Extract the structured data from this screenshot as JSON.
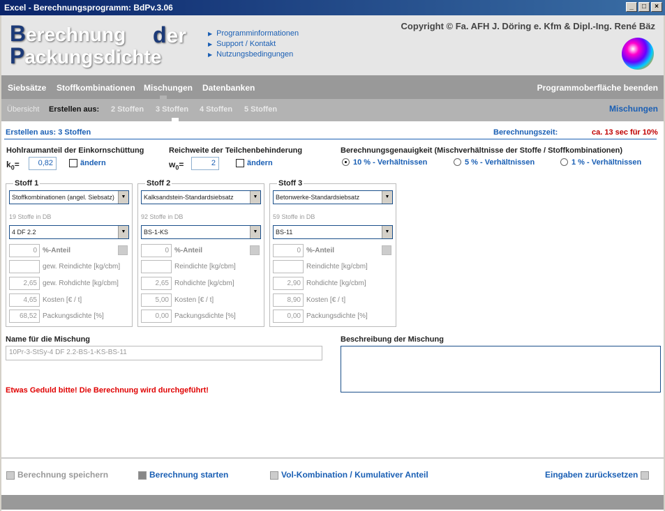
{
  "window": {
    "title": "Excel - Berechnungsprogramm: BdPv.3.06",
    "min_glyph": "_",
    "max_glyph": "□",
    "close_glyph": "×"
  },
  "logo": {
    "line1_cap": "B",
    "line1_rest": "erechnung",
    "der_cap": "d",
    "der_rest": "er",
    "line2_cap": "P",
    "line2_rest": "ackungsdichte"
  },
  "links": [
    "Programminformationen",
    "Support / Kontakt",
    "Nutzungsbedingungen"
  ],
  "copyright": "Copyright © Fa. AFH J. Döring e. Kfm & Dipl.-Ing. René Bäz",
  "nav1": {
    "items": [
      "Siebsätze",
      "Stoffkombinationen",
      "Mischungen",
      "Datenbanken"
    ],
    "exit": "Programmoberfläche beenden"
  },
  "nav2": {
    "overview": "Übersicht",
    "create_label": "Erstellen aus:",
    "items": [
      "2 Stoffen",
      "3 Stoffen",
      "4 Stoffen",
      "5 Stoffen"
    ],
    "section": "Mischungen"
  },
  "section": {
    "title": "Erstellen aus: 3 Stoffen",
    "calc_time_label": "Berechnungszeit:",
    "calc_time_value": "ca. 13 sec für 10%"
  },
  "hohlraum": {
    "label": "Hohlraumanteil der Einkornschüttung",
    "sym": "k",
    "sub": "0",
    "eq": "=",
    "value": "0,82",
    "change": "ändern"
  },
  "reichweite": {
    "label": "Reichweite der Teilchenbehinderung",
    "sym": "w",
    "sub": "0",
    "eq": "=",
    "value": "2",
    "change": "ändern"
  },
  "genauigkeit": {
    "label": "Berechnungsgenauigkeit (Mischverhältnisse der Stoffe / Stoffkombinationen)",
    "options": [
      "10 % - Verhältnissen",
      "5 % - Verhältnissen",
      "1 % - Verhältnissen"
    ],
    "selected": 0
  },
  "stoffe": [
    {
      "title": "Stoff 1",
      "db_select": "Stoffkombinationen (angel. Siebsatz)",
      "db_count": "19 Stoffe in DB",
      "item": "4 DF 2.2",
      "rows": [
        {
          "v": "0",
          "l": "%-Anteil"
        },
        {
          "v": "",
          "l": "gew. Reindichte [kg/cbm]"
        },
        {
          "v": "2,65",
          "l": "gew. Rohdichte [kg/cbm]"
        },
        {
          "v": "4,65",
          "l": "Kosten [€ / t]"
        },
        {
          "v": "68,52",
          "l": "Packungsdichte [%]"
        }
      ]
    },
    {
      "title": "Stoff 2",
      "db_select": "Kalksandstein-Standardsiebsatz",
      "db_count": "92 Stoffe in DB",
      "item": "BS-1-KS",
      "rows": [
        {
          "v": "0",
          "l": "%-Anteil"
        },
        {
          "v": "",
          "l": "Reindichte [kg/cbm]"
        },
        {
          "v": "2,65",
          "l": "Rohdichte [kg/cbm]"
        },
        {
          "v": "5,00",
          "l": "Kosten [€ / t]"
        },
        {
          "v": "0,00",
          "l": "Packungsdichte [%]"
        }
      ]
    },
    {
      "title": "Stoff 3",
      "db_select": "Betonwerke-Standardsiebsatz",
      "db_count": "59 Stoffe in DB",
      "item": "BS-11",
      "rows": [
        {
          "v": "0",
          "l": "%-Anteil"
        },
        {
          "v": "",
          "l": "Reindichte [kg/cbm]"
        },
        {
          "v": "2,90",
          "l": "Rohdichte [kg/cbm]"
        },
        {
          "v": "8,90",
          "l": "Kosten [€ / t]"
        },
        {
          "v": "0,00",
          "l": "Packungsdichte [%]"
        }
      ]
    }
  ],
  "mix": {
    "name_label": "Name für die Mischung",
    "name_value": "10Pr-3-StSy-4 DF 2.2-BS-1-KS-BS-11",
    "desc_label": "Beschreibung der Mischung"
  },
  "warning": "Etwas Geduld bitte! Die Berechnung wird durchgeführt!",
  "actions": {
    "save": "Berechnung speichern",
    "start": "Berechnung starten",
    "vol": "Vol-Kombination / Kumulativer Anteil",
    "reset": "Eingaben zurücksetzen"
  },
  "colors": {
    "accent": "#1a5fb4",
    "warning": "#e00000",
    "nav": "#999999",
    "subnav": "#b3b3b3"
  }
}
